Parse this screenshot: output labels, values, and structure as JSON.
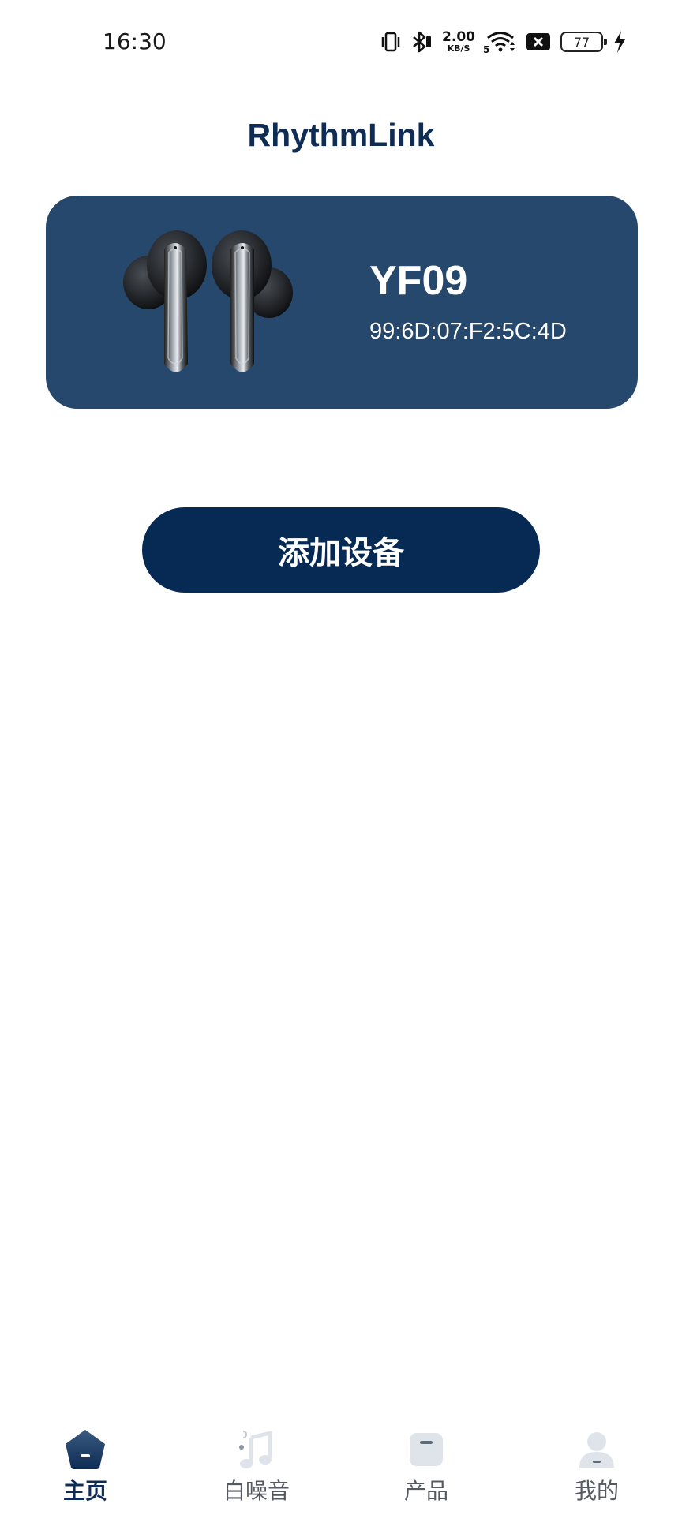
{
  "status_bar": {
    "time": "16:30",
    "net_speed_value": "2.00",
    "net_speed_unit": "KB/S",
    "signal_label": "5",
    "battery_level": "77",
    "icons": [
      "vibrate-icon",
      "bluetooth-icon",
      "wifi-icon",
      "sim-blocked-icon",
      "battery-icon",
      "charging-icon"
    ]
  },
  "app": {
    "title": "RhythmLink"
  },
  "device_card": {
    "name": "YF09",
    "mac": "99:6D:07:F2:5C:4D",
    "image": "earbuds-image"
  },
  "actions": {
    "add_device_label": "添加设备"
  },
  "bottom_nav": {
    "items": [
      {
        "label": "主页",
        "icon": "home-icon",
        "active": true
      },
      {
        "label": "白噪音",
        "icon": "music-note-icon",
        "active": false
      },
      {
        "label": "产品",
        "icon": "product-icon",
        "active": false
      },
      {
        "label": "我的",
        "icon": "user-icon",
        "active": false
      }
    ]
  },
  "colors": {
    "primary": "#062a53",
    "card": "#27486d",
    "title": "#0e2c54",
    "inactive_icon": "#dfe3ea"
  }
}
